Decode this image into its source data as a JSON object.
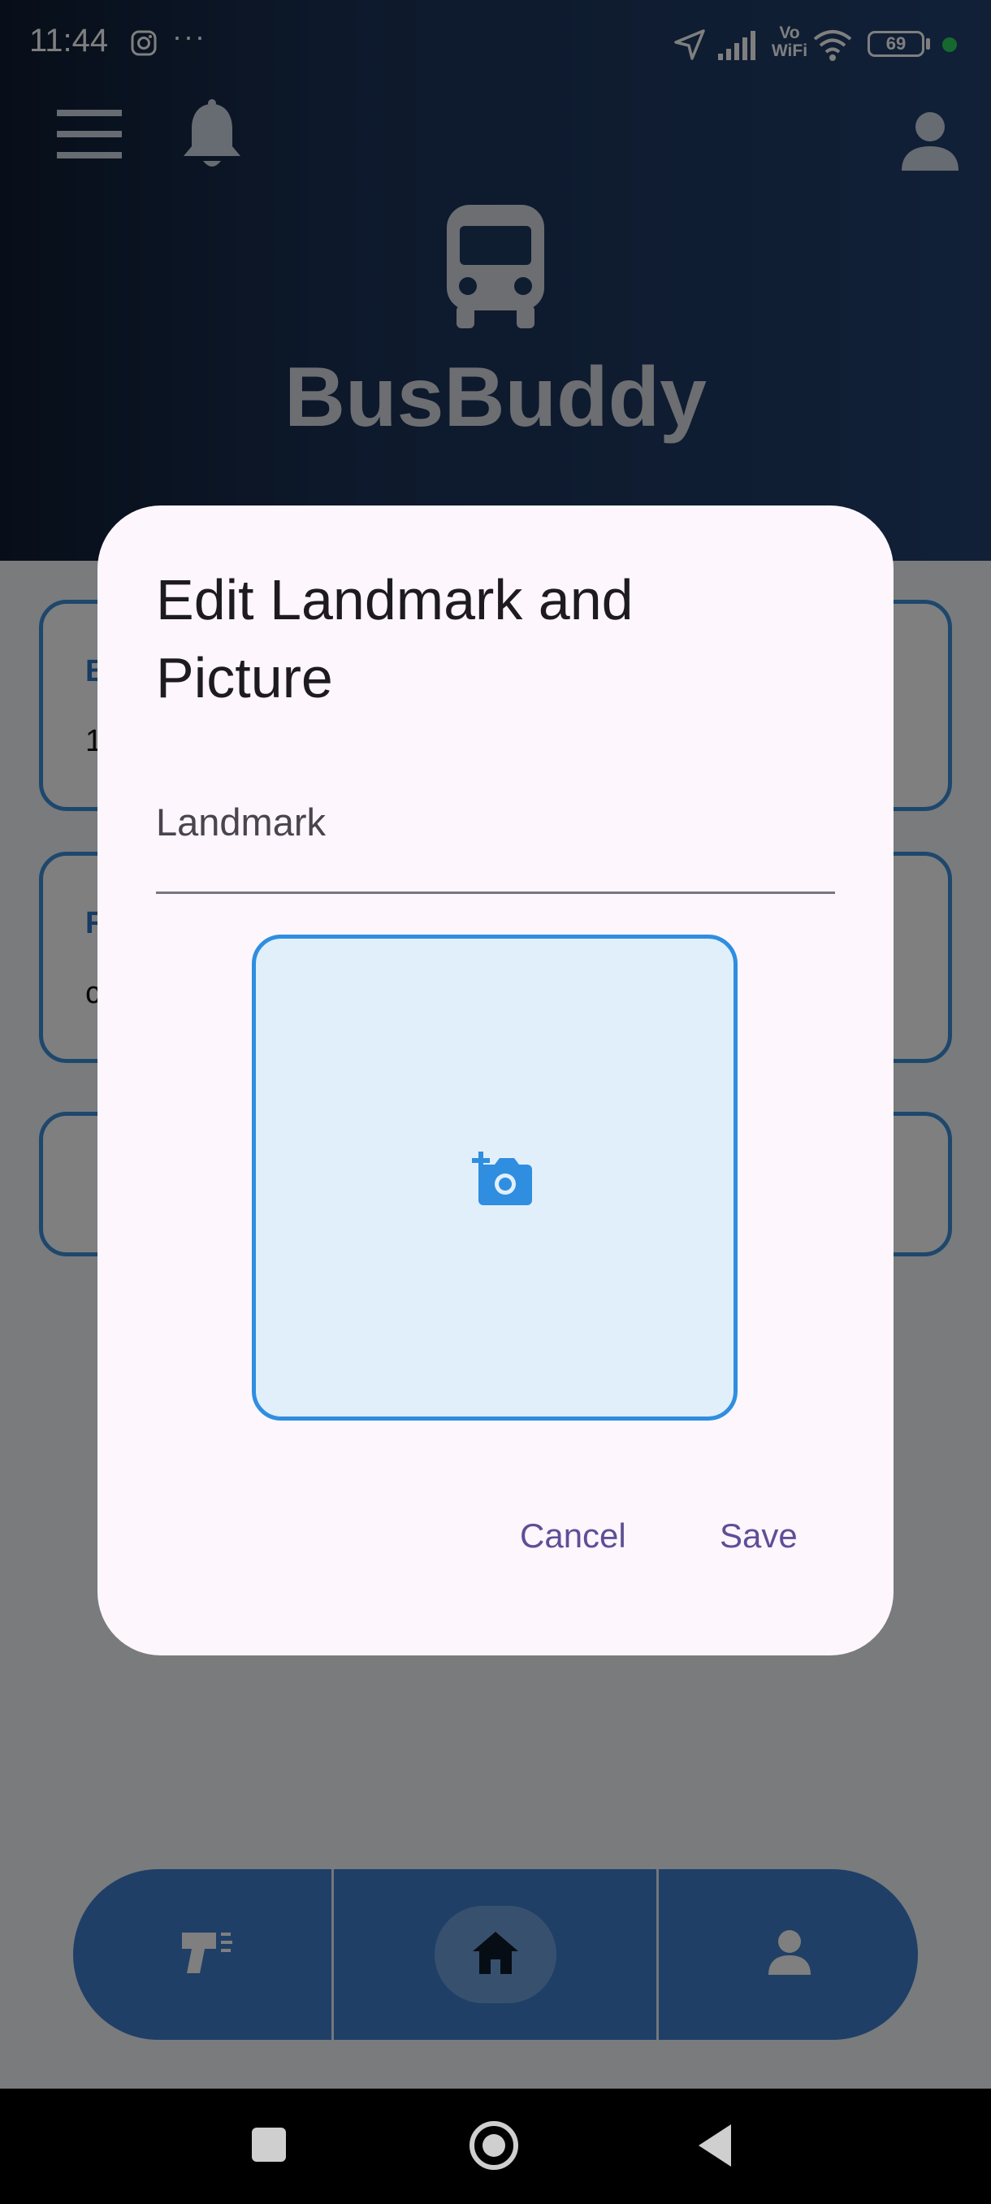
{
  "status_bar": {
    "time": "11:44",
    "more": "···",
    "network_label": "Vo WiFi",
    "battery": "69"
  },
  "app": {
    "title": "BusBuddy",
    "cards": [
      {
        "label": "B",
        "value": "1"
      },
      {
        "label": "R",
        "value": "c"
      }
    ]
  },
  "dialog": {
    "title": "Edit Landmark and Picture",
    "landmark_placeholder": "Landmark",
    "add_photo_icon": "add-a-photo-icon",
    "cancel_label": "Cancel",
    "save_label": "Save"
  },
  "bottom_nav": {
    "items": [
      {
        "icon": "scanner-icon"
      },
      {
        "icon": "home-icon"
      },
      {
        "icon": "person-icon"
      }
    ]
  },
  "colors": {
    "header_bg": "#1b3257",
    "dialog_bg": "#fdf6fd",
    "accent_blue": "#2f8ee0",
    "button_text": "#5d4f96",
    "nav_bg": "#3f7fcf"
  }
}
